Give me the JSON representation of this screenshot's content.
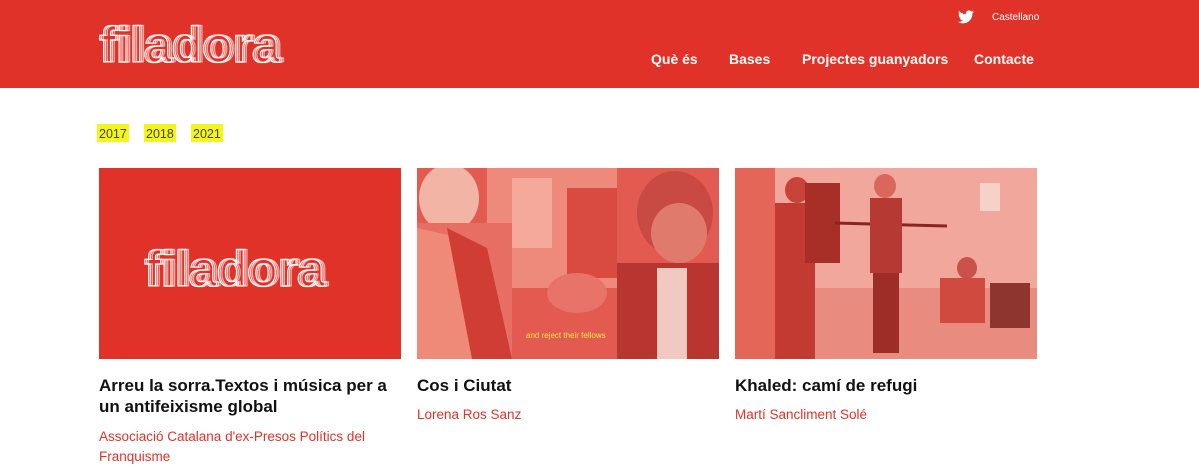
{
  "header": {
    "brand": "filadora",
    "language_link": "Castellano",
    "nav": [
      "Què és",
      "Bases",
      "Projectes guanyadors",
      "Contacte"
    ]
  },
  "years": [
    "2017",
    "2018",
    "2021"
  ],
  "projects": [
    {
      "title": "Arreu la sorra.Textos i música per a un antifeixisme global",
      "author": "Associació Catalana d'ex-Presos Polítics del Franquisme",
      "image": "filadora-logo-placeholder"
    },
    {
      "title": "Cos i Ciutat",
      "author": "Lorena Ros Sanz",
      "image": "video-still-two-people",
      "caption": "and reject their fellows"
    },
    {
      "title": "Khaled: camí de refugi",
      "author": "Martí Sancliment Solé",
      "image": "recording-session-photo"
    }
  ],
  "colors": {
    "brand_red": "#e03228",
    "highlight_yellow": "#f4f51b"
  },
  "icons": [
    "twitter-icon"
  ]
}
